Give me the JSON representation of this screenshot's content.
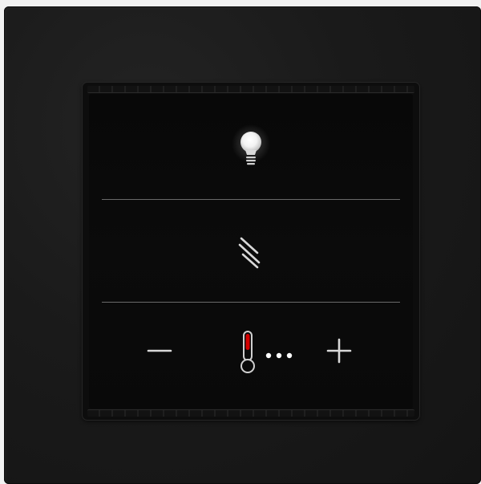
{
  "device": {
    "frame_color": "#1b1b1b",
    "panel_color": "#0b0b0b",
    "divider_color": "#6a6a6a"
  },
  "buttons": {
    "light": {
      "icon": "light-bulb-icon",
      "state": "on",
      "glow_color": "#ffffff"
    },
    "blinds": {
      "icon": "blinds-icon"
    },
    "temp_down": {
      "icon": "minus-icon"
    },
    "temp_up": {
      "icon": "plus-icon"
    }
  },
  "temperature": {
    "icon": "thermometer-icon",
    "indicator_color": "#d40000",
    "level_dots": 3,
    "dot_color": "#ffffff"
  }
}
